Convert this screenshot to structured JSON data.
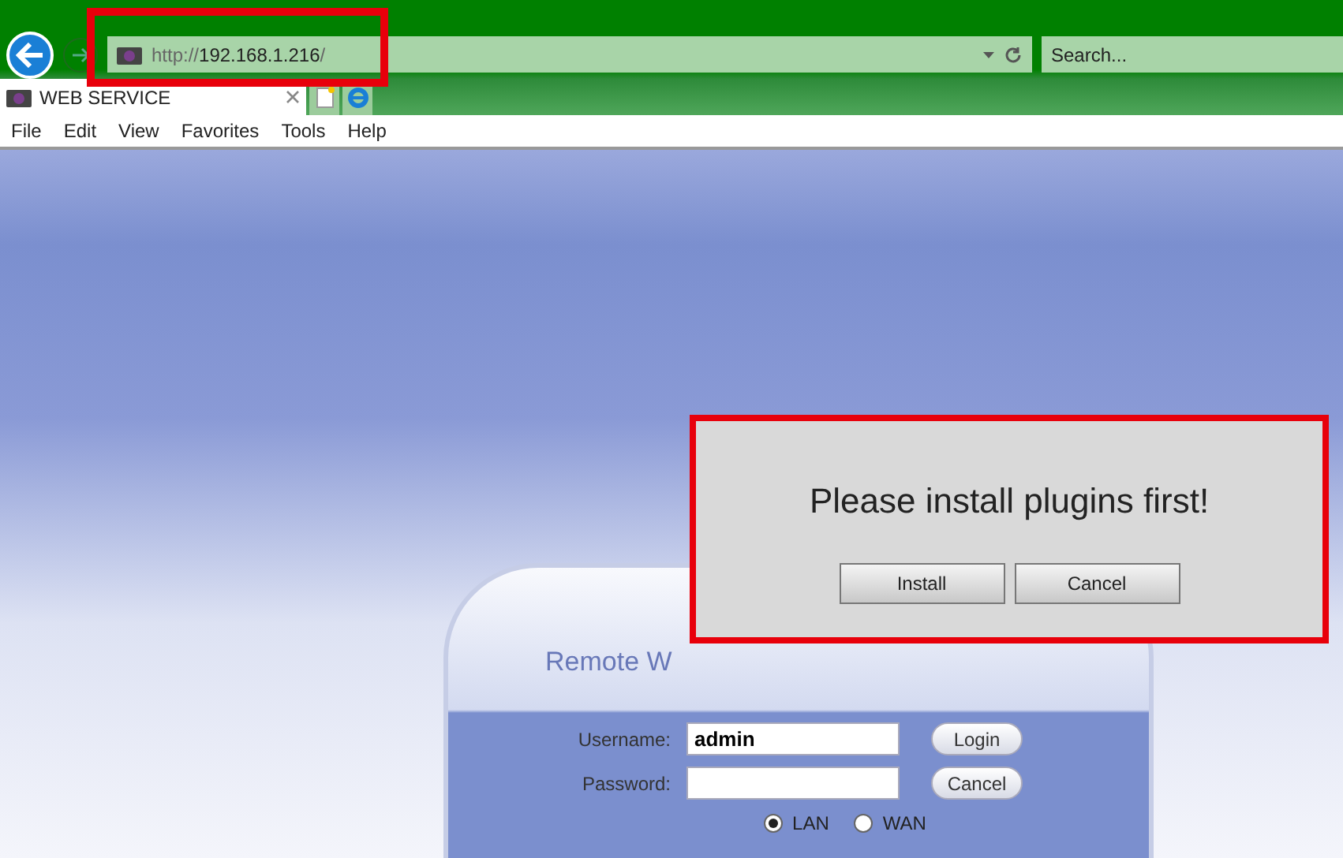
{
  "browser": {
    "address": {
      "scheme": "http://",
      "host": "192.168.1.216",
      "path": "/"
    },
    "search": {
      "placeholder": "Search..."
    },
    "tabs": [
      {
        "title": "WEB SERVICE",
        "selected": true
      }
    ],
    "menu": [
      "File",
      "Edit",
      "View",
      "Favorites",
      "Tools",
      "Help"
    ]
  },
  "login": {
    "title": "Remote W",
    "fields": [
      {
        "label": "Username:",
        "value": "admin",
        "button": "Login"
      },
      {
        "label": "Password:",
        "button": "Cancel"
      }
    ],
    "network": [
      {
        "label": "LAN",
        "selected": true
      },
      {
        "label": "WAN",
        "selected": false
      }
    ]
  },
  "dialog": {
    "message": "Please install plugins first!",
    "buttons": [
      "Install",
      "Cancel"
    ]
  }
}
